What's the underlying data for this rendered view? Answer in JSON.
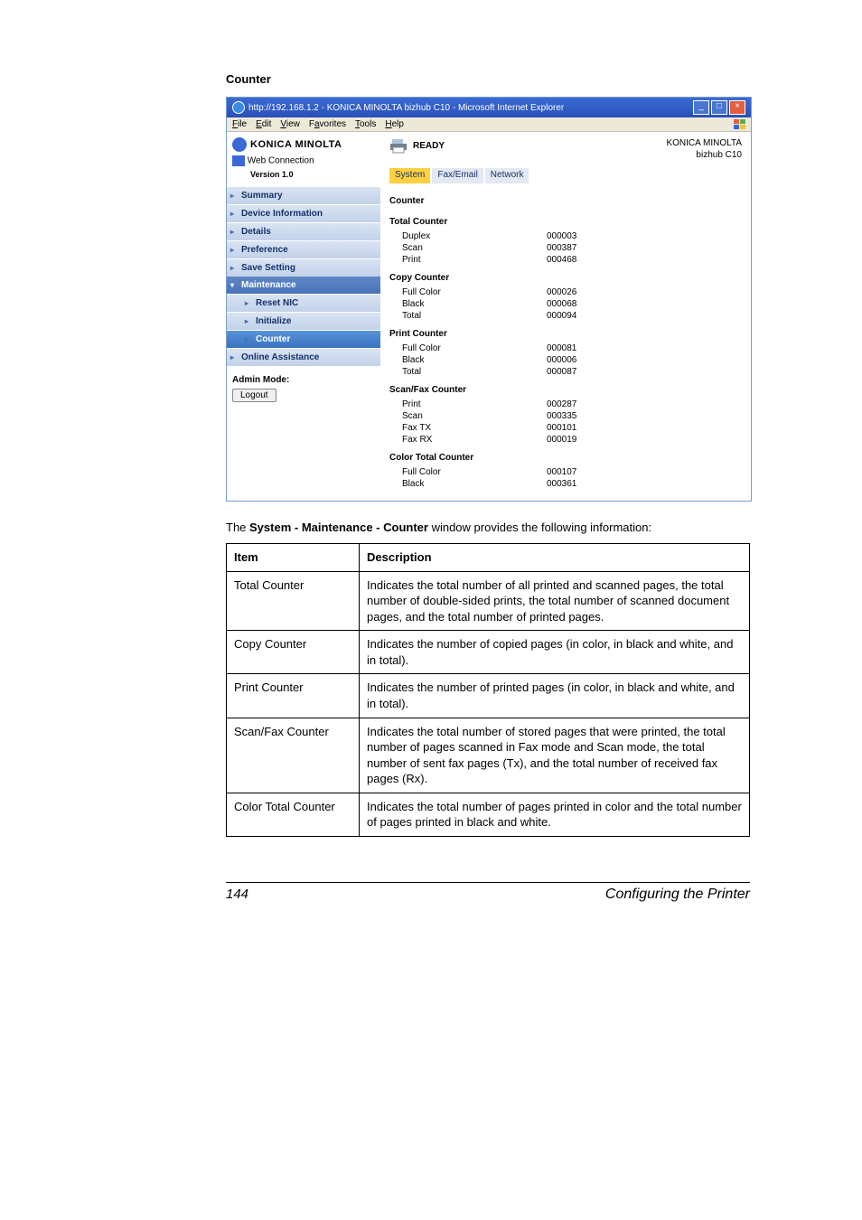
{
  "section_title": "Counter",
  "browser": {
    "title": "http://192.168.1.2 - KONICA MINOLTA bizhub C10 - Microsoft Internet Explorer",
    "menus": [
      "File",
      "Edit",
      "View",
      "Favorites",
      "Tools",
      "Help"
    ]
  },
  "sidebar": {
    "brand": "KONICA MINOLTA",
    "pagescope": "Web Connection",
    "version": "Version 1.0",
    "items": [
      "Summary",
      "Device Information",
      "Details",
      "Preference",
      "Save Setting"
    ],
    "group_head": "Maintenance",
    "subs": [
      "Reset NIC",
      "Initialize",
      "Counter"
    ],
    "last": "Online Assistance",
    "admin_label": "Admin Mode:",
    "logout": "Logout"
  },
  "content": {
    "status": "READY",
    "device_line1": "KONICA MINOLTA",
    "device_line2": "bizhub C10",
    "tabs": [
      "System",
      "Fax/Email",
      "Network"
    ],
    "heading": "Counter",
    "groups": [
      {
        "title": "Total Counter",
        "rows": [
          {
            "label": "Duplex",
            "value": "000003"
          },
          {
            "label": "Scan",
            "value": "000387"
          },
          {
            "label": "Print",
            "value": "000468"
          }
        ]
      },
      {
        "title": "Copy Counter",
        "rows": [
          {
            "label": "Full Color",
            "value": "000026"
          },
          {
            "label": "Black",
            "value": "000068"
          },
          {
            "label": "Total",
            "value": "000094"
          }
        ]
      },
      {
        "title": "Print Counter",
        "rows": [
          {
            "label": "Full Color",
            "value": "000081"
          },
          {
            "label": "Black",
            "value": "000006"
          },
          {
            "label": "Total",
            "value": "000087"
          }
        ]
      },
      {
        "title": "Scan/Fax Counter",
        "rows": [
          {
            "label": "Print",
            "value": "000287"
          },
          {
            "label": "Scan",
            "value": "000335"
          },
          {
            "label": "Fax TX",
            "value": "000101"
          },
          {
            "label": "Fax RX",
            "value": "000019"
          }
        ]
      },
      {
        "title": "Color Total Counter",
        "rows": [
          {
            "label": "Full Color",
            "value": "000107"
          },
          {
            "label": "Black",
            "value": "000361"
          }
        ]
      }
    ]
  },
  "caption_prefix": "The ",
  "caption_bold": "System - Maintenance - Counter",
  "caption_suffix": " window provides the following information:",
  "table": {
    "head_item": "Item",
    "head_desc": "Description",
    "rows": [
      {
        "item": "Total Counter",
        "desc": "Indicates the total number of all printed and scanned pages, the total number of double-sided prints, the total number of scanned document pages, and the total number of printed pages."
      },
      {
        "item": "Copy Counter",
        "desc": "Indicates the number of copied pages (in color, in black and white, and in total)."
      },
      {
        "item": "Print Counter",
        "desc": "Indicates the number of printed pages (in color, in black and white, and in total)."
      },
      {
        "item": "Scan/Fax Counter",
        "desc": "Indicates the total number of stored pages that were printed, the total number of pages scanned in Fax mode and Scan mode, the total number of sent fax pages (Tx), and the total number of received fax pages (Rx)."
      },
      {
        "item": "Color Total Counter",
        "desc": "Indicates the total number of pages printed in color and the total number of pages printed in black and white."
      }
    ]
  },
  "footer": {
    "page": "144",
    "title": "Configuring the Printer"
  }
}
